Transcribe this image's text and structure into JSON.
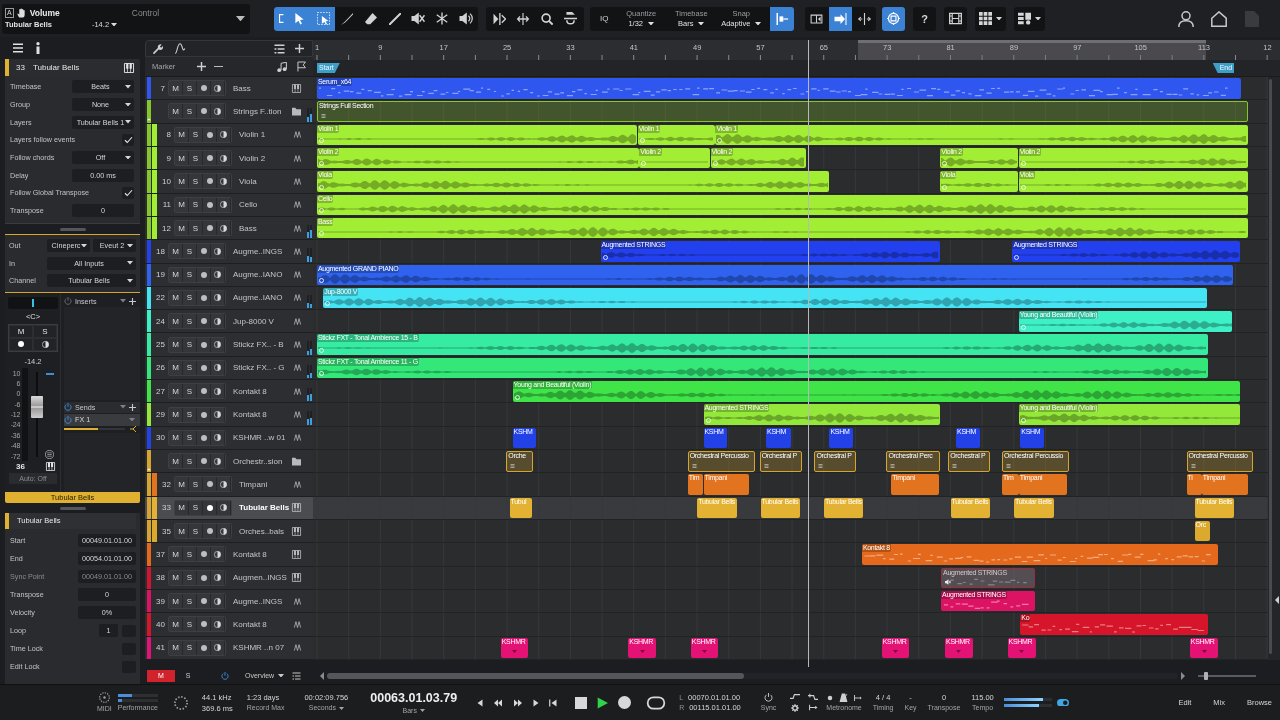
{
  "toolbar": {
    "control": {
      "badge": "A",
      "parameter": "Volume",
      "section": "Control",
      "track": "Tubular Bells",
      "value": "-14.2"
    },
    "tools": [
      {
        "kind": "range",
        "selected": true
      },
      {
        "kind": "select",
        "selected": true
      },
      {
        "kind": "box-select",
        "selected": true
      },
      {
        "kind": "split",
        "selected": false
      },
      {
        "kind": "erase",
        "selected": false
      },
      {
        "kind": "draw",
        "selected": false
      },
      {
        "kind": "mute",
        "selected": false
      },
      {
        "kind": "glue",
        "selected": false
      },
      {
        "kind": "listen",
        "selected": false
      }
    ],
    "edit_tools": [
      {
        "kind": "snap-zero"
      },
      {
        "kind": "stretch"
      },
      {
        "kind": "zoom"
      },
      {
        "kind": "comp"
      }
    ],
    "quantize_button": "IQ",
    "quantize": [
      {
        "label": "Quantize",
        "value": "1/32"
      },
      {
        "label": "Timebase",
        "value": "Bars"
      },
      {
        "label": "Snap",
        "value": "Adaptive"
      }
    ],
    "snap": {
      "on": true
    },
    "zones": [
      {
        "kind": "left",
        "on": false
      },
      {
        "kind": "right",
        "on": true
      },
      {
        "kind": "split",
        "on": false
      }
    ],
    "focus": {
      "on": true
    },
    "help": "?",
    "views": [
      {
        "kind": "video"
      },
      {
        "kind": "grid"
      },
      {
        "kind": "layout"
      }
    ],
    "account": [
      {
        "kind": "user"
      },
      {
        "kind": "home"
      },
      {
        "kind": "page"
      }
    ]
  },
  "inspector": {
    "tabs": [
      {
        "kind": "menu"
      },
      {
        "kind": "info"
      }
    ],
    "track": {
      "number": "33",
      "name": "Tubular Bells"
    },
    "settings": [
      {
        "kind": "dropdown",
        "label": "Timebase",
        "value": "Beats"
      },
      {
        "kind": "dropdown",
        "label": "Group",
        "value": "None"
      },
      {
        "kind": "dropdown",
        "label": "Layers",
        "value": "Tubular Bells 1"
      },
      {
        "kind": "checkbox",
        "label": "Layers follow events",
        "checked": true
      },
      {
        "kind": "dropdown",
        "label": "Follow chords",
        "value": "Off"
      },
      {
        "kind": "field",
        "label": "Delay",
        "value": "0.00 ms"
      },
      {
        "kind": "checkbox",
        "label": "Follow Global Transpose",
        "checked": true
      },
      {
        "kind": "field",
        "label": "Transpose",
        "value": "0"
      }
    ],
    "routing": [
      {
        "label": "Out",
        "values": [
          "Cineperc",
          "Eveut 2"
        ]
      },
      {
        "label": "In",
        "values": [
          "All Inputs"
        ]
      },
      {
        "label": "Channel",
        "values": [
          "Tubular Bells"
        ]
      }
    ],
    "channel": {
      "pan": {
        "level": 0.5,
        "label": "<C>"
      },
      "buttons": [
        "M",
        "S"
      ],
      "record": true,
      "volume": "-14.2",
      "scale": [
        "10",
        "6",
        "0",
        "-6",
        "-12",
        "-24",
        "-36",
        "-48",
        "-72"
      ],
      "fader": {
        "level": 0.58
      },
      "number": "36",
      "automation": "Auto: Off",
      "name": "Tubular Bells"
    },
    "inserts": {
      "label": "Inserts",
      "on": false
    },
    "sends": {
      "label": "Sends",
      "on": true,
      "slots": [
        {
          "label": "FX 1",
          "on": true,
          "level": 0.55
        }
      ]
    },
    "event": {
      "name": "Tubular Bells",
      "fields": [
        {
          "kind": "field",
          "label": "Start",
          "value": "00049.01.01.00",
          "disabled": false
        },
        {
          "kind": "field",
          "label": "End",
          "value": "00054.01.01.00",
          "disabled": false
        },
        {
          "kind": "field",
          "label": "Sync Point",
          "value": "00049.01.01.00",
          "disabled": true
        },
        {
          "kind": "field",
          "label": "Transpose",
          "value": "0",
          "disabled": false
        },
        {
          "kind": "field",
          "label": "Velocity",
          "value": "0%",
          "disabled": false
        },
        {
          "kind": "loop",
          "label": "Loop",
          "value": "1",
          "checked": false,
          "disabled": false
        },
        {
          "kind": "checkbox",
          "label": "Time Lock",
          "checked": false,
          "disabled": false
        },
        {
          "kind": "checkbox",
          "label": "Edit Lock",
          "checked": false,
          "disabled": false
        }
      ]
    }
  },
  "tracklist": {
    "tools": [
      {
        "kind": "wrench"
      },
      {
        "kind": "curve"
      },
      {
        "kind": "list"
      },
      {
        "kind": "plus"
      }
    ],
    "marker_label": "Marker",
    "marker_tools": [
      {
        "kind": "plus"
      },
      {
        "kind": "minus"
      },
      {
        "kind": "note"
      },
      {
        "kind": "flag"
      }
    ]
  },
  "ruler": {
    "labels": [
      "1",
      "9",
      "17",
      "25",
      "33",
      "41",
      "49",
      "57",
      "65",
      "73",
      "81",
      "89",
      "97",
      "105",
      "113",
      "12"
    ],
    "markers": [
      {
        "kind": "start",
        "label": "Start"
      },
      {
        "kind": "end",
        "label": "End"
      }
    ]
  },
  "tracks": [
    {
      "number": "7",
      "name": "Bass",
      "kind": "instrument",
      "color": "#2f56ee",
      "selected": false,
      "record": false,
      "buttons": [
        "M",
        "S"
      ],
      "clips": [
        {
          "kind": "midi",
          "label": "Serum_x64"
        }
      ]
    },
    {
      "name": "Strings F..tion",
      "kind": "folder",
      "color": "#86c62c",
      "selected": false,
      "record": false,
      "expanded": true,
      "buttons": [
        "M",
        "S"
      ],
      "meters": [
        {
          "level": 0.35
        },
        {
          "level": 0.6
        }
      ],
      "clips": [
        {
          "kind": "folder",
          "label": "Strings Full Section"
        }
      ],
      "children": [
        {
          "number": "8",
          "name": "Violin 1",
          "kind": "audio",
          "color": "#a2ee34",
          "selected": false,
          "record": false,
          "buttons": [
            "M",
            "S"
          ],
          "clips": [
            {
              "kind": "audio",
              "label": "Violin 1"
            },
            {
              "kind": "audio",
              "label": "Violin 1"
            },
            {
              "kind": "audio",
              "label": "Violin 1"
            }
          ]
        },
        {
          "number": "9",
          "name": "Violin 2",
          "kind": "audio",
          "color": "#a2ee34",
          "selected": false,
          "record": false,
          "buttons": [
            "M",
            "S"
          ],
          "clips": [
            {
              "kind": "audio",
              "label": "Violin 2"
            },
            {
              "kind": "audio",
              "label": "Violin 2"
            },
            {
              "kind": "audio",
              "label": "Violin 2"
            },
            {
              "kind": "audio",
              "label": "Violin 2"
            },
            {
              "kind": "audio",
              "label": "Violin 2"
            }
          ]
        },
        {
          "number": "10",
          "name": "Viola",
          "kind": "audio",
          "color": "#a2ee34",
          "selected": false,
          "record": false,
          "buttons": [
            "M",
            "S"
          ],
          "clips": [
            {
              "kind": "audio",
              "label": "Viola"
            },
            {
              "kind": "audio",
              "label": "Viola"
            },
            {
              "kind": "audio",
              "label": "Viola"
            }
          ]
        },
        {
          "number": "11",
          "name": "Cello",
          "kind": "audio",
          "color": "#a2ee34",
          "selected": false,
          "record": false,
          "buttons": [
            "M",
            "S"
          ],
          "clips": [
            {
              "kind": "audio",
              "label": "Cello"
            }
          ]
        },
        {
          "number": "12",
          "name": "Bass",
          "kind": "audio",
          "color": "#a2ee34",
          "selected": false,
          "record": false,
          "buttons": [
            "M",
            "S"
          ],
          "meters": [
            {
              "level": 0.45
            },
            {
              "level": 0.6
            }
          ],
          "clips": [
            {
              "kind": "audio",
              "label": "Bass"
            }
          ]
        }
      ]
    },
    {
      "number": "18",
      "name": "Augme..INGS",
      "kind": "audio",
      "color": "#2340ee",
      "selected": false,
      "record": false,
      "buttons": [
        "M",
        "S"
      ],
      "meters": [
        {
          "level": 0.4
        },
        {
          "level": 0.35
        }
      ],
      "clips": [
        {
          "kind": "audio",
          "label": "Augmented STRINGS"
        },
        {
          "kind": "audio",
          "label": "Augmented STRINGS"
        }
      ]
    },
    {
      "number": "19",
      "name": "Augme..IANO",
      "kind": "audio",
      "color": "#2f63ef",
      "selected": false,
      "record": false,
      "buttons": [
        "M",
        "S"
      ],
      "clips": [
        {
          "kind": "audio",
          "label": "Augmented GRAND PIANO"
        }
      ]
    },
    {
      "number": "22",
      "name": "Augme..IANO",
      "kind": "audio",
      "color": "#45e4f4",
      "selected": false,
      "record": false,
      "buttons": [
        "M",
        "S"
      ],
      "meters": [
        {
          "level": 0.4
        },
        {
          "level": 0.3
        }
      ],
      "clips": [
        {
          "kind": "audio",
          "label": "Jup-8000 V"
        }
      ]
    },
    {
      "number": "24",
      "name": "Jup-8000 V",
      "kind": "audio",
      "color": "#3ef0c6",
      "selected": false,
      "record": false,
      "buttons": [
        "M",
        "S"
      ],
      "clips": [
        {
          "kind": "audio",
          "label": "Young and Beautiful (Violin)"
        }
      ]
    },
    {
      "number": "25",
      "name": "Stickz FX.. - B",
      "kind": "audio",
      "color": "#36eba2",
      "selected": false,
      "record": false,
      "buttons": [
        "M",
        "S"
      ],
      "meters": [
        {
          "level": 0.3
        },
        {
          "level": 0.45
        }
      ],
      "clips": [
        {
          "kind": "audio",
          "label": "Stickz FXT - Tonal Ambience 15 - B"
        }
      ]
    },
    {
      "number": "26",
      "name": "Stickz FX.. - G",
      "kind": "audio",
      "color": "#33e878",
      "selected": false,
      "record": false,
      "buttons": [
        "M",
        "S"
      ],
      "meters": [
        {
          "level": 0.25
        },
        {
          "level": 0.4
        }
      ],
      "clips": [
        {
          "kind": "audio",
          "label": "Stickz FXT - Tonal Ambience 11 - G"
        }
      ]
    },
    {
      "number": "27",
      "name": "Kontakt 8",
      "kind": "audio",
      "color": "#3fe548",
      "selected": false,
      "record": false,
      "buttons": [
        "M",
        "S"
      ],
      "meters": [
        {
          "level": 0.5
        },
        {
          "level": 0.55
        }
      ],
      "clips": [
        {
          "kind": "audio",
          "label": "Young and Beautiful (Violin)"
        }
      ]
    },
    {
      "number": "29",
      "name": "Kontakt 8",
      "kind": "audio",
      "color": "#93e83a",
      "selected": false,
      "record": false,
      "buttons": [
        "M",
        "S"
      ],
      "meters": [
        {
          "level": 0.45
        },
        {
          "level": 0.5
        }
      ],
      "clips": [
        {
          "kind": "audio",
          "label": "Augmented STRINGS"
        },
        {
          "kind": "audio",
          "label": "Young and Beautiful (Violin)"
        }
      ]
    },
    {
      "number": "30",
      "name": "KSHMR ..w 01",
      "kind": "audio",
      "color": "#2241e6",
      "selected": false,
      "record": false,
      "buttons": [
        "M",
        "S"
      ],
      "clips": [
        {
          "kind": "plain",
          "label": "KSHM"
        },
        {
          "kind": "plain",
          "label": "KSHM"
        },
        {
          "kind": "plain",
          "label": "KSHM"
        },
        {
          "kind": "plain",
          "label": "KSHM"
        },
        {
          "kind": "plain",
          "label": "KSHM"
        },
        {
          "kind": "plain",
          "label": "KSHM"
        }
      ]
    },
    {
      "name": "Orchestr..sion",
      "kind": "folder",
      "color": "#d6a52f",
      "selected": false,
      "record": false,
      "expanded": true,
      "buttons": [
        "M",
        "S"
      ],
      "clips": [
        {
          "kind": "folder",
          "label": "Orche"
        },
        {
          "kind": "folder",
          "label": "Orchestral Percussio"
        },
        {
          "kind": "folder",
          "label": "Orchestral P"
        },
        {
          "kind": "folder",
          "label": "Orchestral P"
        },
        {
          "kind": "folder",
          "label": "Orchestral Perc"
        },
        {
          "kind": "folder",
          "label": "Orchestral P"
        },
        {
          "kind": "folder",
          "label": "Orchestral Percussio"
        },
        {
          "kind": "folder",
          "label": "Orchestral Percussio"
        }
      ],
      "children": [
        {
          "number": "32",
          "name": "Timpani",
          "kind": "audio",
          "color": "#e2741f",
          "selected": false,
          "record": false,
          "buttons": [
            "M",
            "S"
          ],
          "clips": [
            {
              "kind": "plain",
              "label": "Tim"
            },
            {
              "kind": "plain",
              "label": "Timpani"
            },
            {
              "kind": "plain",
              "label": "Timpani"
            },
            {
              "kind": "plain",
              "label": "Tim"
            },
            {
              "kind": "plain",
              "label": "Timpani"
            },
            {
              "kind": "plain",
              "label": "Ti"
            },
            {
              "kind": "plain",
              "label": "Timpani"
            }
          ]
        },
        {
          "number": "33",
          "name": "Tubular Bells",
          "kind": "instrument",
          "color": "#e3b233",
          "selected": true,
          "record": true,
          "buttons": [
            "M",
            "S"
          ],
          "clips": [
            {
              "kind": "plain",
              "label": "Tubul"
            },
            {
              "kind": "plain",
              "label": "Tubular Bells"
            },
            {
              "kind": "plain",
              "label": "Tubular Bells"
            },
            {
              "kind": "plain",
              "label": "Tubular Bells"
            },
            {
              "kind": "plain",
              "label": "Tubular Bells"
            },
            {
              "kind": "plain",
              "label": "Tubular Bells"
            },
            {
              "kind": "plain",
              "label": "Tubular Bells"
            }
          ]
        },
        {
          "number": "35",
          "name": "Orches..bals",
          "kind": "instrument",
          "color": "#dba92e",
          "selected": false,
          "record": false,
          "buttons": [
            "M",
            "S"
          ],
          "clips": [
            {
              "kind": "plain",
              "label": "Orc"
            }
          ]
        }
      ]
    },
    {
      "number": "37",
      "name": "Kontakt 8",
      "kind": "instrument",
      "color": "#e4691c",
      "selected": false,
      "record": false,
      "buttons": [
        "M",
        "S"
      ],
      "clips": [
        {
          "kind": "midi",
          "label": "Kontakt 8"
        }
      ]
    },
    {
      "number": "38",
      "name": "Augmen..INGS",
      "kind": "instrument",
      "color": "#d3142f",
      "selected": false,
      "record": false,
      "buttons": [
        "M",
        "S"
      ],
      "clips": [
        {
          "kind": "muted",
          "label": "Augmented STRINGS"
        }
      ]
    },
    {
      "number": "39",
      "name": "Augme..INGS",
      "kind": "audio",
      "color": "#dc1362",
      "selected": false,
      "record": false,
      "buttons": [
        "M",
        "S"
      ],
      "clips": [
        {
          "kind": "midi",
          "label": "Augmented STRINGS"
        }
      ]
    },
    {
      "number": "40",
      "name": "Kontakt 8",
      "kind": "audio",
      "color": "#d6152a",
      "selected": false,
      "record": false,
      "buttons": [
        "M",
        "S"
      ],
      "clips": [
        {
          "kind": "midi",
          "label": "Ko"
        }
      ]
    },
    {
      "number": "41",
      "name": "KSHMR ..n 07",
      "kind": "audio",
      "color": "#e31274",
      "selected": false,
      "record": false,
      "buttons": [
        "M",
        "S"
      ],
      "clips": [
        {
          "kind": "marked",
          "label": "KSHMR"
        },
        {
          "kind": "marked",
          "label": "KSHMR"
        },
        {
          "kind": "marked",
          "label": "KSHMR"
        },
        {
          "kind": "marked",
          "label": "KSHMR"
        },
        {
          "kind": "marked",
          "label": "KSHMR"
        },
        {
          "kind": "marked",
          "label": "KSHMR"
        },
        {
          "kind": "marked",
          "label": "KSHMR"
        }
      ]
    }
  ],
  "overview": {
    "toggles": [
      {
        "label": "M",
        "on": true
      },
      {
        "label": "S",
        "on": false
      }
    ],
    "power": {
      "on": true
    },
    "view": "Overview",
    "zoom": {
      "level": 0.14
    }
  },
  "transport": {
    "midi": {
      "label": "MIDI"
    },
    "performance": {
      "label": "Performance",
      "meters": [
        {
          "level": 0.35
        },
        {
          "level": 0.1
        }
      ]
    },
    "audio": {
      "rate": "44.1 kHz",
      "latency": "369.6 ms"
    },
    "record_time": {
      "value": "1:23 days",
      "label": "Record Max"
    },
    "secondary": {
      "value": "00:02:09.756",
      "format": "Seconds"
    },
    "primary": {
      "value": "00063.01.03.79",
      "format": "Bars"
    },
    "controls": [
      {
        "kind": "prev-marker",
        "on": false
      },
      {
        "kind": "rewind",
        "on": false
      },
      {
        "kind": "forward",
        "on": false
      },
      {
        "kind": "next-marker",
        "on": false
      },
      {
        "kind": "to-start",
        "on": false
      },
      {
        "kind": "stop",
        "on": false
      },
      {
        "kind": "play",
        "on": true
      },
      {
        "kind": "record",
        "on": false
      },
      {
        "kind": "cycle",
        "on": false
      }
    ],
    "locators": [
      {
        "label": "L",
        "value": "00070.01.01.00"
      },
      {
        "label": "R",
        "value": "00115.01.01.00"
      }
    ],
    "sync": {
      "label": "Sync"
    },
    "punch": [
      {
        "kind": "punch-in"
      },
      {
        "kind": "punch-out"
      },
      {
        "kind": "settings"
      },
      {
        "kind": "pre-roll"
      }
    ],
    "metronome": {
      "label": "Metronome",
      "icons": [
        {
          "kind": "click"
        },
        {
          "kind": "metronome"
        },
        {
          "kind": "count-in"
        }
      ]
    },
    "readouts": [
      {
        "value": "4 / 4",
        "label": "Timing"
      },
      {
        "value": "-",
        "label": "Key"
      },
      {
        "value": "0",
        "label": "Transpose"
      },
      {
        "value": "115.00",
        "label": "Tempo"
      }
    ],
    "output": {
      "meters": [
        {
          "level": 0.82
        },
        {
          "level": 0.74
        }
      ]
    },
    "zones": [
      {
        "label": "Edit"
      },
      {
        "label": "Mix"
      },
      {
        "label": "Browse"
      }
    ]
  }
}
